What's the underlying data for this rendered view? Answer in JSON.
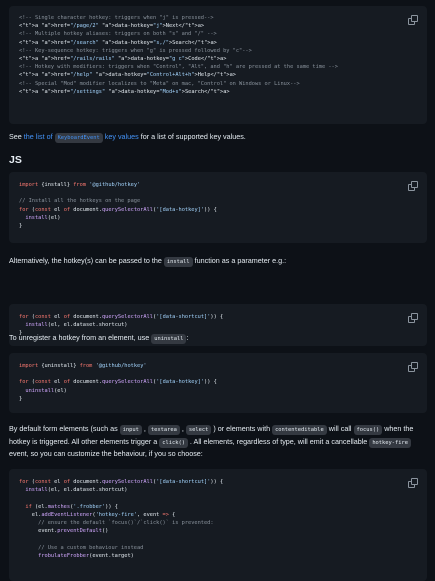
{
  "code_blocks": {
    "html_example": [
      "<!-- Single character hotkey: triggers when \"j\" is pressed-->",
      "<a href=\"/page/2\" data-hotkey=\"j\">Next</a>",
      "<!-- Multiple hotkey aliases: triggers on both \"s\" and \"/\" -->",
      "<a href=\"/search\" data-hotkey=\"s,/\">Search</a>",
      "<!-- Key-sequence hotkey: triggers when \"g\" is pressed followed by \"c\"-->",
      "<a href=\"/rails/rails\" data-hotkey=\"g c\">Code</a>",
      "<!-- Hotkey with modifiers: triggers when \"Control\", \"Alt\", and \"h\" are pressed at the same time -->",
      "<a href=\"/help\" data-hotkey=\"Control+Alt+h\">Help</a>",
      "<!-- Special \"Mod\" modifier localizes to \"Meta\" on mac, \"Control\" on Windows or Linux-->",
      "<a href=\"/settings\" data-hotkey=\"Mod+s\">Search</a>"
    ],
    "install_example": [
      "import {install} from '@github/hotkey'",
      "",
      "// Install all the hotkeys on the page",
      "for (const el of document.querySelectorAll('[data-hotkey]')) {",
      "  install(el)",
      "}"
    ],
    "shortcut_example": [
      "for (const el of document.querySelectorAll('[data-shortcut]')) {",
      "  install(el, el.dataset.shortcut)",
      "}"
    ],
    "uninstall_example": [
      "import {uninstall} from '@github/hotkey'",
      "",
      "for (const el of document.querySelectorAll('[data-hotkey]')) {",
      "  uninstall(el)",
      "}"
    ],
    "event_example": [
      "for (const el of document.querySelectorAll('[data-shortcut]')) {",
      "  install(el, el.dataset.shortcut)",
      "",
      "  if (el.matches('.frobber')) {",
      "    el.addEventListener('hotkey-fire', event => {",
      "      // ensure the default `focus()`/`click()` is prevented:",
      "      event.preventDefault()",
      "",
      "      // Use a custom behaviour instead",
      "      frobulateFrobber(event.target)"
    ]
  },
  "text": {
    "see_prefix": "See ",
    "see_link_1": "the list of",
    "see_code": "KeyboardEvent",
    "see_link_2": "key values",
    "see_suffix": " for a list of supported key values.",
    "js_heading": "JS",
    "alt_prefix": "Alternatively, the hotkey(s) can be passed to the ",
    "alt_code": "install",
    "alt_suffix": " function as a parameter e.g.:",
    "unreg_prefix": "To unregister a hotkey from an element, use ",
    "unreg_code": "uninstall",
    "unreg_suffix": ":",
    "default_1": "By default form elements (such as ",
    "default_code_input": "input",
    "default_comma_1": " , ",
    "default_code_textarea": "textarea",
    "default_comma_2": " , ",
    "default_code_select": "select",
    "default_2": " ) or elements with ",
    "default_code_editable": "contenteditable",
    "default_3": " will call ",
    "default_code_focus": "focus()",
    "default_4": " when the hotkey is triggered. All other elements trigger a ",
    "default_code_click": "click()",
    "default_5": " . All elements, regardless of type, will emit a cancellable ",
    "default_code_fire": "hotkey-fire",
    "default_6": " event, so you can customize the behaviour, if you so choose:"
  },
  "icons": {
    "copy": "copy-icon"
  }
}
